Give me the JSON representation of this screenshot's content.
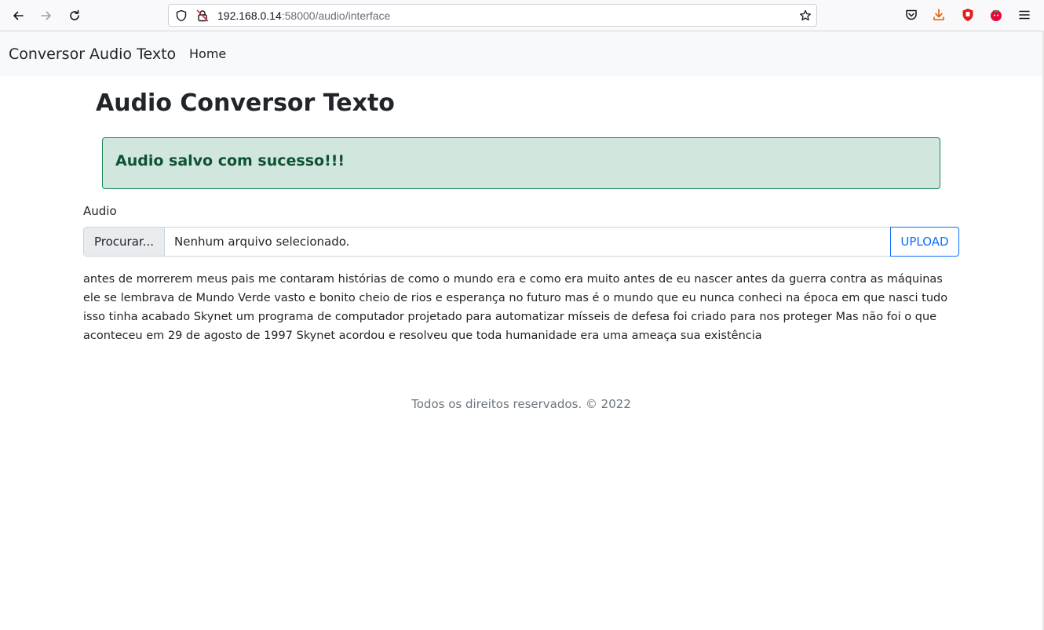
{
  "browser": {
    "url_host": "192.168.0.14",
    "url_path": ":58000/audio/interface",
    "icons": [
      "back-arrow-icon",
      "forward-arrow-icon",
      "reload-icon",
      "shield-icon",
      "insecure-lock-icon",
      "bookmark-star-icon",
      "pocket-icon",
      "download-icon",
      "ublock-icon",
      "extension-icon",
      "menu-icon"
    ],
    "colors": {
      "download": "#e66000",
      "ublock": "#e31c1c",
      "extension": "#e30b3c"
    }
  },
  "navbar": {
    "brand": "Conversor Audio Texto",
    "home_link": "Home"
  },
  "main": {
    "title": "Audio Conversor Texto",
    "alert": "Audio salvo com sucesso!!!",
    "audio_label": "Audio",
    "file_button": "Procurar...",
    "file_name": "Nenhum arquivo selecionado.",
    "upload_button": "UPLOAD",
    "transcript": "antes de morrerem meus pais me contaram histórias de como o mundo era e como era muito antes de eu nascer antes da guerra contra as máquinas ele se lembrava de Mundo Verde vasto e bonito cheio de rios e esperança no futuro mas é o mundo que eu nunca conheci na época em que nasci tudo isso tinha acabado Skynet um programa de computador projetado para automatizar mísseis de defesa foi criado para nos proteger Mas não foi o que aconteceu em 29 de agosto de 1997 Skynet acordou e resolveu que toda humanidade era uma ameaça sua existência"
  },
  "footer": {
    "text": "Todos os direitos reservados. © 2022"
  },
  "colors": {
    "alert_bg": "#d1e7dd",
    "alert_border": "#198754",
    "alert_text": "#0f5132",
    "primary": "#0d6efd",
    "navbar_bg": "#f8f9fa"
  }
}
